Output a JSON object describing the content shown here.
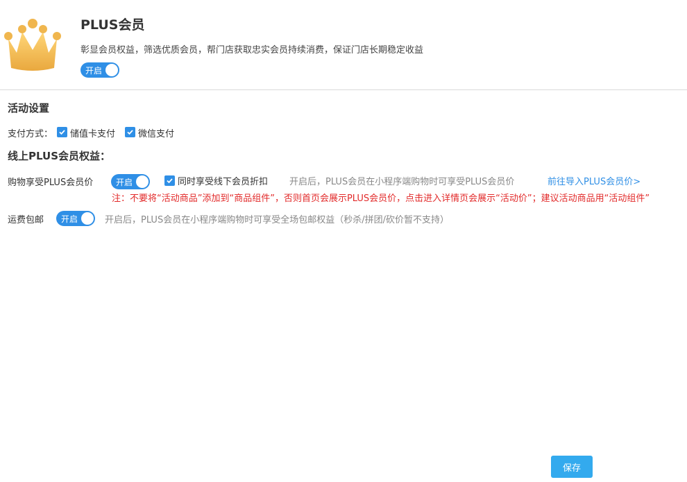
{
  "header": {
    "title": "PLUS会员",
    "subtitle": "彰显会员权益，筛选优质会员，帮门店获取忠实会员持续消费，保证门店长期稳定收益",
    "toggle_label": "开启",
    "crown_icon": "crown-icon"
  },
  "activity": {
    "heading": "活动设置",
    "payment_label": "支付方式：",
    "options": [
      {
        "label": "储值卡支付",
        "checked": true
      },
      {
        "label": "微信支付",
        "checked": true
      }
    ]
  },
  "online": {
    "heading": "线上PLUS会员权益：",
    "price_label": "购物享受PLUS会员价",
    "price_toggle": "开启",
    "offline_discount_label": "同时享受线下会员折扣",
    "price_hint": "开启后，PLUS会员在小程序端购物时可享受PLUS会员价",
    "import_link": "前往导入PLUS会员价>",
    "note": "注：不要将“活动商品”添加到“商品组件”，否则首页会展示PLUS会员价，点击进入详情页会展示“活动价”；建议活动商品用“活动组件”",
    "shipping_label": "运费包邮",
    "shipping_toggle": "开启",
    "shipping_hint": "开启后，PLUS会员在小程序端购物时可享受全场包邮权益（秒杀/拼团/砍价暂不支持）"
  },
  "footer": {
    "save_label": "保存"
  },
  "colors": {
    "accent": "#2f8fe6",
    "save": "#33aaee",
    "note": "#e22a2a",
    "crown": "#f5c25a"
  }
}
